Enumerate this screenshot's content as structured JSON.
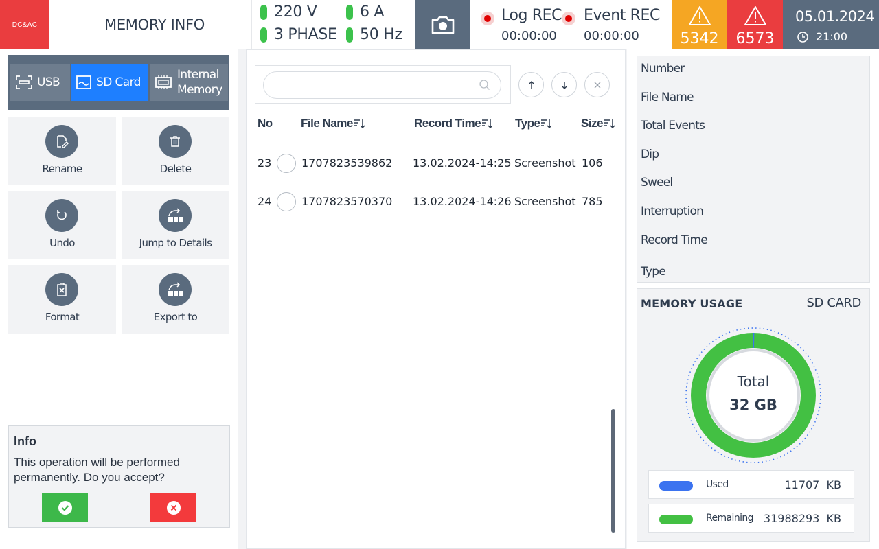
{
  "header": {
    "logo_text": "DC&AC",
    "title": "MEMORY INFO",
    "voltage": "220 V",
    "phase": "3 PHASE",
    "current": "6 A",
    "frequency": "50 Hz",
    "camera_icon": "camera-icon",
    "log_rec_label": "Log REC",
    "log_rec_time": "00:00:00",
    "event_rec_label": "Event REC",
    "event_rec_time": "00:00:00",
    "warning_count": "5342",
    "alarm_count": "6573",
    "date": "05.01.2024",
    "time": "21:00",
    "colors": {
      "warning": "#f5a623",
      "alarm": "#ea3d3f",
      "status_ok": "#3cc24c",
      "rec": "#e00000"
    }
  },
  "storage_tabs": [
    {
      "label": "USB",
      "icon": "usb-icon",
      "active": false
    },
    {
      "label": "SD Card",
      "icon": "sd-card-icon",
      "active": true
    },
    {
      "label_line1": "Internal",
      "label_line2": "Memory",
      "icon": "chip-icon",
      "active": false
    }
  ],
  "actions": {
    "rename": "Rename",
    "delete": "Delete",
    "undo": "Undo",
    "jump": "Jump to Details",
    "format": "Format",
    "export": "Export to"
  },
  "info": {
    "title": "Info",
    "message": "This operation will be performed permanently. Do you accept?"
  },
  "search": {
    "placeholder": "",
    "value": ""
  },
  "file_table": {
    "columns": {
      "no": "No",
      "file_name": "File Name",
      "record_time": "Record Time",
      "type": "Type",
      "size": "Size"
    },
    "rows": [
      {
        "no": "23",
        "file_name": "1707823539862",
        "record_time": "13.02.2024-14:25",
        "type": "Screenshot",
        "size": "106"
      },
      {
        "no": "24",
        "file_name": "1707823570370",
        "record_time": "13.02.2024-14:26",
        "type": "Screenshot",
        "size": "785"
      }
    ]
  },
  "details": {
    "number": "Number",
    "file_name": "File Name",
    "total_events": "Total Events",
    "dip": "Dip",
    "sweel": "Sweel",
    "interruption": "Interruption",
    "record_time": "Record Time",
    "type": "Type"
  },
  "memory_usage": {
    "title": "MEMORY USAGE",
    "source": "SD CARD",
    "total_label": "Total",
    "total_value": "32 GB",
    "used_label": "Used",
    "used_value": "11707",
    "used_unit": "KB",
    "remaining_label": "Remaining",
    "remaining_value": "31988293",
    "remaining_unit": "KB",
    "used_fraction": 0.00037,
    "colors": {
      "used": "#3b73f0",
      "remaining": "#43c043"
    }
  }
}
